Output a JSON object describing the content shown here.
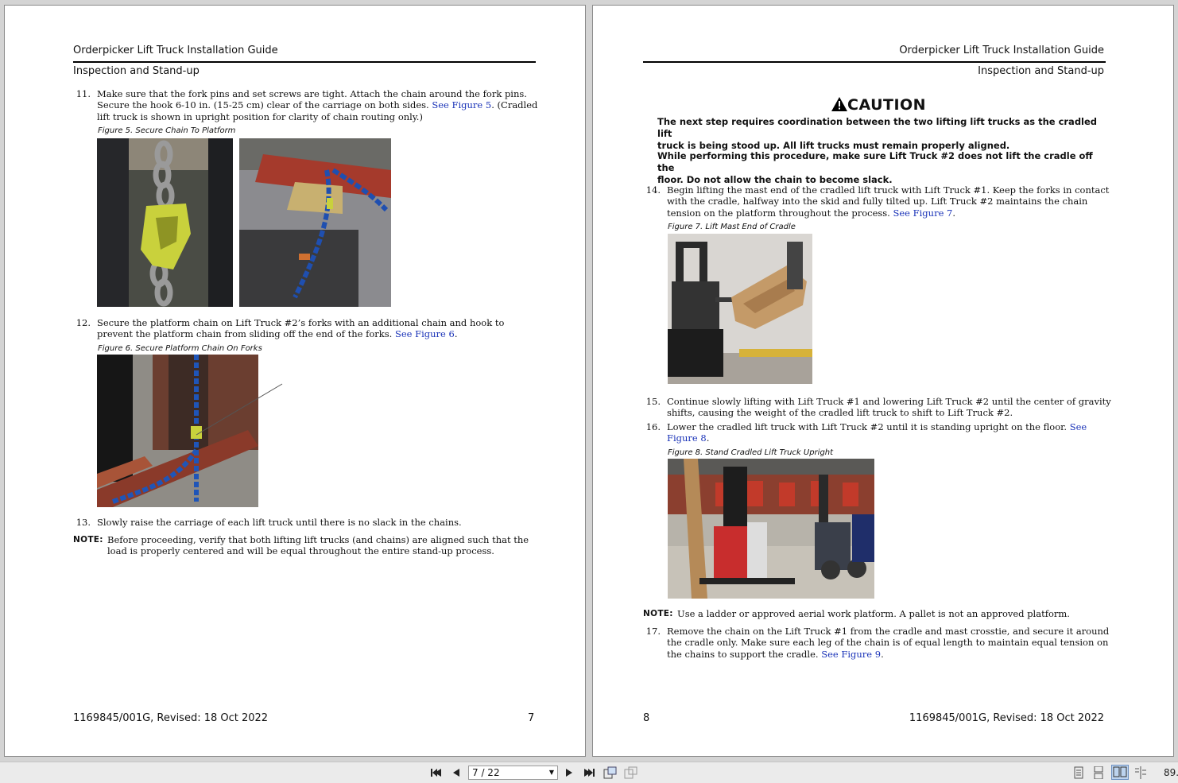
{
  "left_page": {
    "header_title": "Orderpicker Lift Truck Installation Guide",
    "header_section": "Inspection and Stand-up",
    "step11": {
      "num": "11.",
      "line1": "Make sure that the fork pins and set screws are tight. Attach the chain around the fork pins.",
      "line2a": "Secure the hook 6-10 in. (15-25 cm) clear of the carriage on both sides. ",
      "line2_link": "See Figure 5",
      "line2b": ". (Cradled",
      "line3": "lift truck is shown in upright position for clarity of chain routing only.)"
    },
    "fig5_caption": "Figure 5. Secure Chain To Platform",
    "step12": {
      "num": "12.",
      "line1": "Secure the platform chain on Lift Truck #2’s forks with an additional chain and hook to",
      "line2a": "prevent the platform chain from sliding off the end of the forks. ",
      "line2_link": "See Figure 6",
      "line2b": "."
    },
    "fig6_caption": "Figure 6. Secure Platform Chain On Forks",
    "step13": {
      "num": "13.",
      "line1": "Slowly raise the carriage of each lift truck until there is no slack in the chains."
    },
    "note": {
      "label": "NOTE:",
      "line1": "Before proceeding, verify that both lifting lift trucks (and chains) are aligned such that the",
      "line2": "load is properly centered and will be equal throughout the entire stand-up process."
    },
    "footer_doc": "1169845/001G, Revised: 18 Oct 2022",
    "footer_page": "7"
  },
  "right_page": {
    "header_title": "Orderpicker Lift Truck Installation Guide",
    "header_section": "Inspection and Stand-up",
    "caution_title": "CAUTION",
    "caution_p1_l1": "The next step requires coordination between the two lifting lift trucks as the cradled lift",
    "caution_p1_l2": "truck is being stood up. All lift trucks must remain properly aligned.",
    "caution_p2_l1": "While performing this procedure, make sure Lift Truck #2 does not lift the cradle off the",
    "caution_p2_l2": "floor. Do not allow the chain to become slack.",
    "step14": {
      "num": "14.",
      "line1": "Begin lifting the mast end of the cradled lift truck with Lift Truck #1. Keep the forks in contact",
      "line2": "with the cradle, halfway into the skid and fully tilted up. Lift Truck #2 maintains the chain",
      "line3a": "tension on the platform throughout the process. ",
      "line3_link": "See Figure 7",
      "line3b": "."
    },
    "fig7_caption": "Figure 7. Lift Mast End of Cradle",
    "step15": {
      "num": "15.",
      "line1": "Continue slowly lifting with Lift Truck #1 and lowering Lift Truck #2 until the center of gravity",
      "line2": "shifts, causing the weight of the cradled lift truck to shift to Lift Truck #2."
    },
    "step16": {
      "num": "16.",
      "line1a": "Lower the cradled lift truck with Lift Truck #2 until it is standing upright on the floor. ",
      "line1_link": "See",
      "line2_link": "Figure 8",
      "line2b": "."
    },
    "fig8_caption": "Figure 8. Stand Cradled Lift Truck Upright",
    "note": {
      "label": "NOTE:",
      "line1": "Use a ladder or approved aerial work platform. A pallet is not an approved platform."
    },
    "step17": {
      "num": "17.",
      "line1": "Remove the chain on the Lift Truck #1 from the cradle and mast crosstie, and secure it around",
      "line2": "the cradle only. Make sure each leg of the chain is of equal length to maintain equal tension on",
      "line3a": "the chains to support the cradle. ",
      "line3_link": "See Figure 9",
      "line3b": "."
    },
    "footer_page": "8",
    "footer_doc": "1169845/001G, Revised: 18 Oct 2022"
  },
  "toolbar": {
    "page_indicator": "7 / 22",
    "zoom": "89.",
    "icons": [
      "first-page-icon",
      "prev-page-icon",
      "next-page-icon",
      "last-page-icon",
      "rotate-icon",
      "fit-icon",
      "single-page-icon",
      "continuous-icon",
      "two-page-icon",
      "two-page-continuous-icon"
    ]
  },
  "colors": {
    "link": "#1a33b8",
    "background": "#d4d4d4",
    "toolbar": "#ebebeb"
  }
}
